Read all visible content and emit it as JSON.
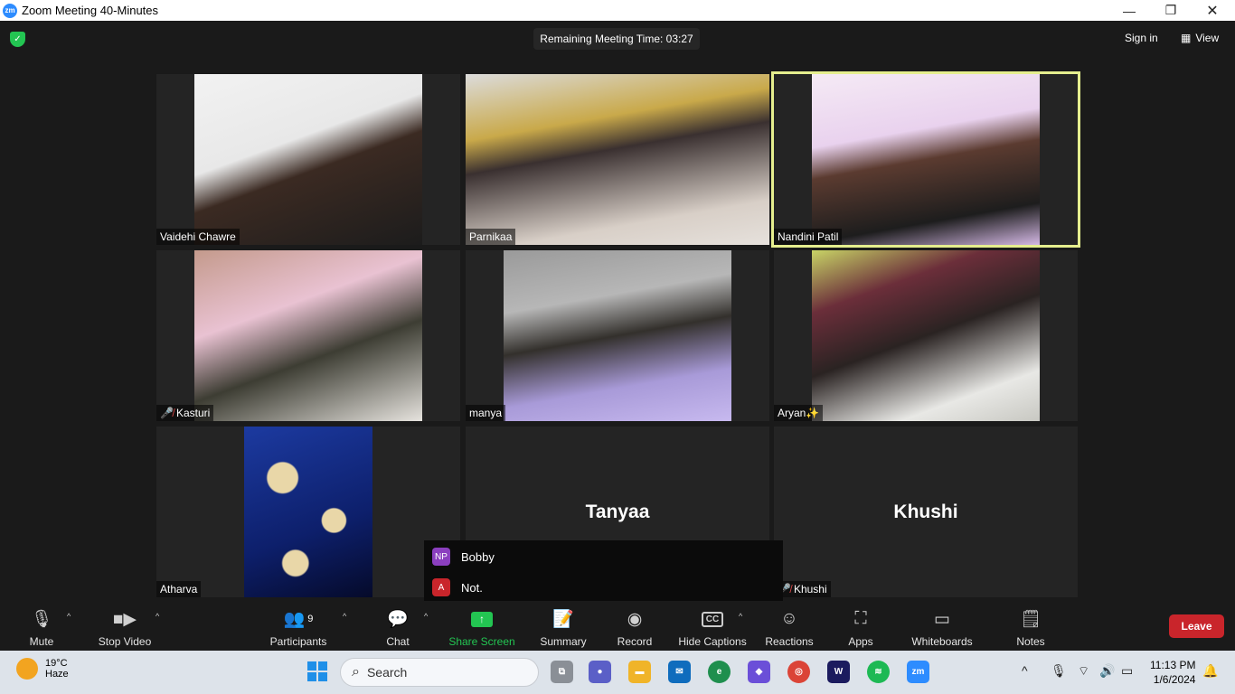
{
  "window": {
    "title": "Zoom Meeting 40-Minutes",
    "logo": "zm"
  },
  "header": {
    "timer": "Remaining Meeting Time: 03:27",
    "sign_in": "Sign in",
    "view": "View"
  },
  "participants": [
    {
      "name": "Vaidehi Chawre",
      "muted": false,
      "active_speaker": false,
      "video": true
    },
    {
      "name": "Parnikaa",
      "muted": false,
      "active_speaker": false,
      "video": true
    },
    {
      "name": "Nandini Patil",
      "muted": false,
      "active_speaker": true,
      "video": true
    },
    {
      "name": "Kasturi",
      "muted": true,
      "active_speaker": false,
      "video": true
    },
    {
      "name": "manya",
      "muted": false,
      "active_speaker": false,
      "video": true
    },
    {
      "name": "Aryan✨",
      "muted": false,
      "active_speaker": false,
      "video": true
    },
    {
      "name": "Atharva",
      "muted": false,
      "active_speaker": false,
      "video": true
    },
    {
      "name": "Tanyaa",
      "display_name": "Tanyaa",
      "tag": "yaa",
      "muted": false,
      "active_speaker": false,
      "video": false
    },
    {
      "name": "Khushi",
      "display_name": "Khushi",
      "muted": true,
      "active_speaker": false,
      "video": false
    }
  ],
  "popup": {
    "rows": [
      {
        "initials": "NP",
        "label": "Bobby",
        "color": "#8b3fbf"
      },
      {
        "initials": "A",
        "label": "Not.",
        "color": "#c9252b"
      }
    ]
  },
  "toolbar": {
    "mute": "Mute",
    "stop_video": "Stop Video",
    "participants": "Participants",
    "participants_count": "9",
    "chat": "Chat",
    "share_screen": "Share Screen",
    "summary": "Summary",
    "record": "Record",
    "captions": "Hide Captions",
    "cc": "CC",
    "reactions": "Reactions",
    "apps": "Apps",
    "whiteboards": "Whiteboards",
    "notes": "Notes",
    "leave": "Leave"
  },
  "taskbar": {
    "temp": "19°C",
    "condition": "Haze",
    "search_placeholder": "Search",
    "time": "11:13 PM",
    "date": "1/6/2024",
    "zoom_app_label": "zm"
  },
  "colors": {
    "accent_green": "#23c552",
    "active_border": "#e5ee8e",
    "leave": "#c9252b",
    "zoom_blue": "#2d8cff"
  }
}
